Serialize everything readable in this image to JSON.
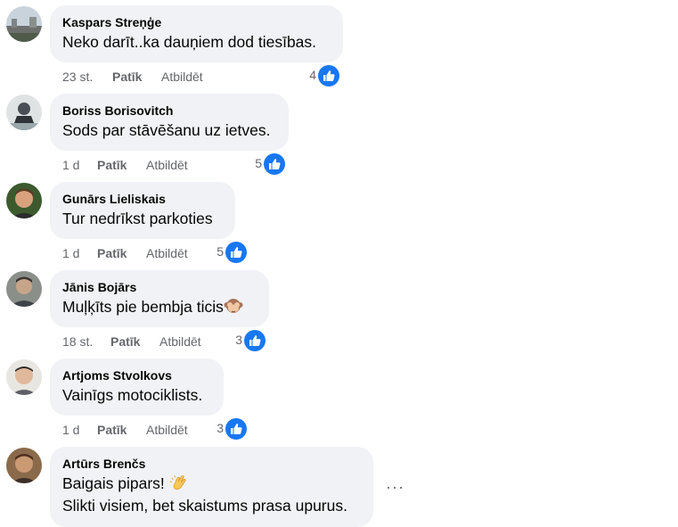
{
  "comments": [
    {
      "author": "Kaspars Streņģe",
      "text": "Neko darīt..ka dauņiem dod tiesības.",
      "time": "23 st.",
      "like": "Patīk",
      "reply": "Atbildēt",
      "reactions": "4"
    },
    {
      "author": "Boriss Borisovitch",
      "text": "Sods par stāvēšanu uz ietves.",
      "time": "1 d",
      "like": "Patīk",
      "reply": "Atbildēt",
      "reactions": "5"
    },
    {
      "author": "Gunārs Lieliskais",
      "text": "Tur nedrīkst parkoties",
      "time": "1 d",
      "like": "Patīk",
      "reply": "Atbildēt",
      "reactions": "5"
    },
    {
      "author": "Jānis Bojārs",
      "text": "Muļķīts pie bembja ticis",
      "emoji": "see-no-evil-monkey-icon",
      "time": "18 st.",
      "like": "Patīk",
      "reply": "Atbildēt",
      "reactions": "3"
    },
    {
      "author": "Artjoms Stvolkovs",
      "text": "Vainīgs motociklists.",
      "time": "1 d",
      "like": "Patīk",
      "reply": "Atbildēt",
      "reactions": "3"
    },
    {
      "author": "Artūrs Brenčs",
      "text": "Baigais pipars!",
      "emoji": "clapping-hands-icon",
      "text2": "Slikti visiem, bet skaistums prasa upurus."
    }
  ],
  "more_options": "···",
  "colors": {
    "bubble": "#f0f2f5",
    "like_blue": "#1877f2",
    "meta_grey": "#65676b"
  }
}
